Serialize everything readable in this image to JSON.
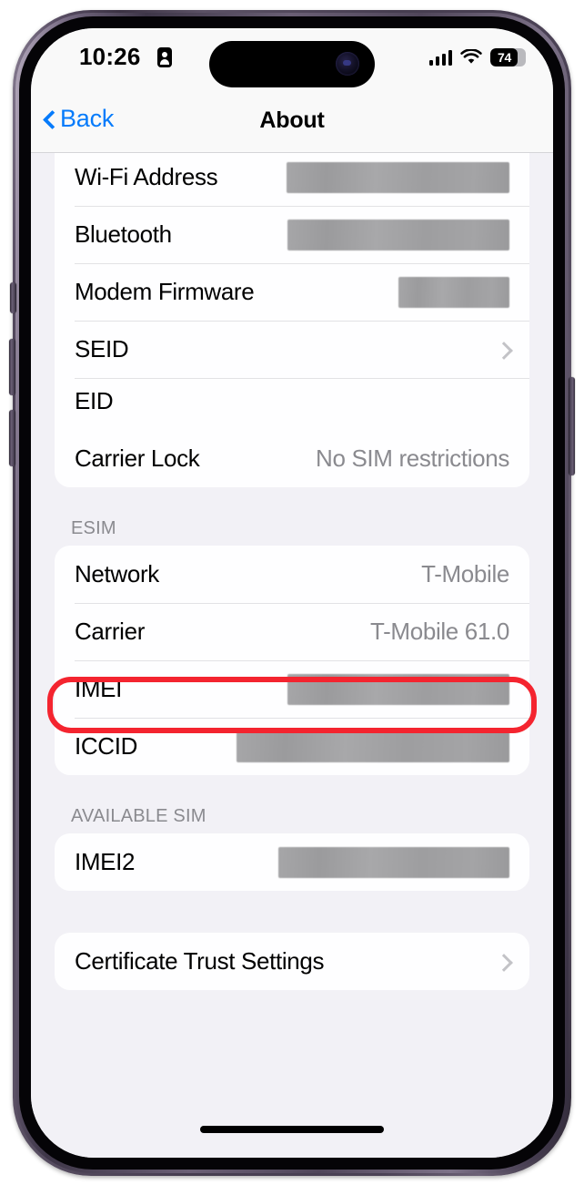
{
  "statusbar": {
    "time": "10:26",
    "record_icon": "id-card-icon",
    "signal_icon": "cellular-signal-icon",
    "wifi_icon": "wifi-icon",
    "battery_level": "74"
  },
  "navbar": {
    "back_label": "Back",
    "title": "About"
  },
  "groups": [
    {
      "header": "",
      "rows": [
        {
          "label": "Wi-Fi Address",
          "value": "",
          "redacted": true,
          "chevron": false
        },
        {
          "label": "Bluetooth",
          "value": "",
          "redacted": true,
          "chevron": false
        },
        {
          "label": "Modem Firmware",
          "value": "",
          "redacted": true,
          "chevron": false
        },
        {
          "label": "SEID",
          "value": "",
          "redacted": false,
          "chevron": true
        },
        {
          "label": "EID",
          "value": "",
          "redacted": true,
          "chevron": false,
          "stacked": true
        },
        {
          "label": "Carrier Lock",
          "value": "No SIM restrictions",
          "redacted": false,
          "chevron": false
        }
      ]
    },
    {
      "header": "ESIM",
      "rows": [
        {
          "label": "Network",
          "value": "T-Mobile",
          "redacted": false,
          "chevron": false
        },
        {
          "label": "Carrier",
          "value": "T-Mobile 61.0",
          "redacted": false,
          "chevron": false,
          "highlighted": true
        },
        {
          "label": "IMEI",
          "value": "",
          "redacted": true,
          "chevron": false
        },
        {
          "label": "ICCID",
          "value": "",
          "redacted": true,
          "chevron": false
        }
      ]
    },
    {
      "header": "AVAILABLE SIM",
      "rows": [
        {
          "label": "IMEI2",
          "value": "",
          "redacted": true,
          "chevron": false
        }
      ]
    },
    {
      "header": "",
      "rows": [
        {
          "label": "Certificate Trust Settings",
          "value": "",
          "redacted": false,
          "chevron": true
        }
      ]
    }
  ],
  "colors": {
    "accent_blue": "#067bfb",
    "highlight_red": "#f4242f",
    "value_gray": "#8a8a8f",
    "page_bg": "#f2f1f6",
    "card_bg": "#fefeff"
  }
}
